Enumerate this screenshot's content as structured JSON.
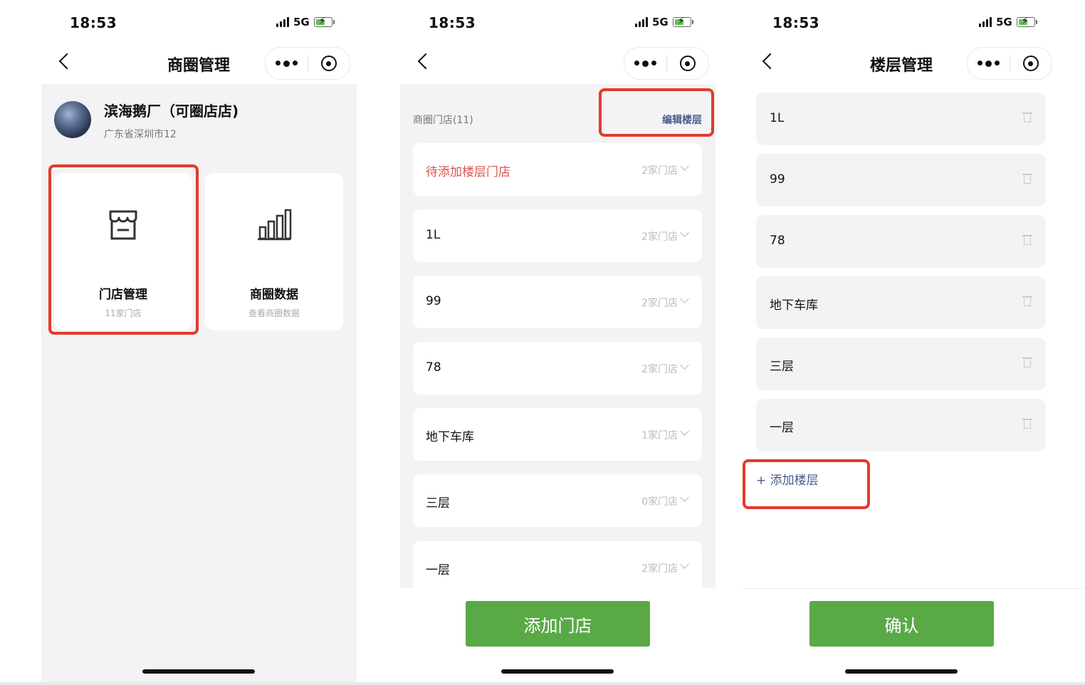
{
  "status": {
    "time": "18:53",
    "network": "5G"
  },
  "screen1": {
    "title": "商圈管理",
    "mall_name": "滨海鹅厂（可圈店店)",
    "mall_address": "广东省深圳市12",
    "cards": [
      {
        "title": "门店管理",
        "subtitle": "11家门店",
        "icon": "storefront-icon"
      },
      {
        "title": "商圈数据",
        "subtitle": "查看商圈数据",
        "icon": "bar-chart-icon"
      }
    ]
  },
  "screen2": {
    "list_header": "商圈门店(11)",
    "edit_link": "编辑楼层",
    "rows": [
      {
        "label": "待添加楼层门店",
        "count": "2家门店"
      },
      {
        "label": "1L",
        "count": "2家门店"
      },
      {
        "label": "99",
        "count": "2家门店"
      },
      {
        "label": "78",
        "count": "2家门店"
      },
      {
        "label": "地下车库",
        "count": "1家门店"
      },
      {
        "label": "三层",
        "count": "0家门店"
      },
      {
        "label": "一层",
        "count": "2家门店"
      }
    ],
    "add_button": "添加门店"
  },
  "screen3": {
    "title": "楼层管理",
    "floors": [
      "1L",
      "99",
      "78",
      "地下车库",
      "三层",
      "一层"
    ],
    "add_floor": "+ 添加楼层",
    "confirm_button": "确认"
  },
  "colors": {
    "accent_green": "#5aa947",
    "highlight_red": "#e53a2a",
    "pending_red": "#d9534f",
    "link_blue": "#4a5a8a"
  }
}
